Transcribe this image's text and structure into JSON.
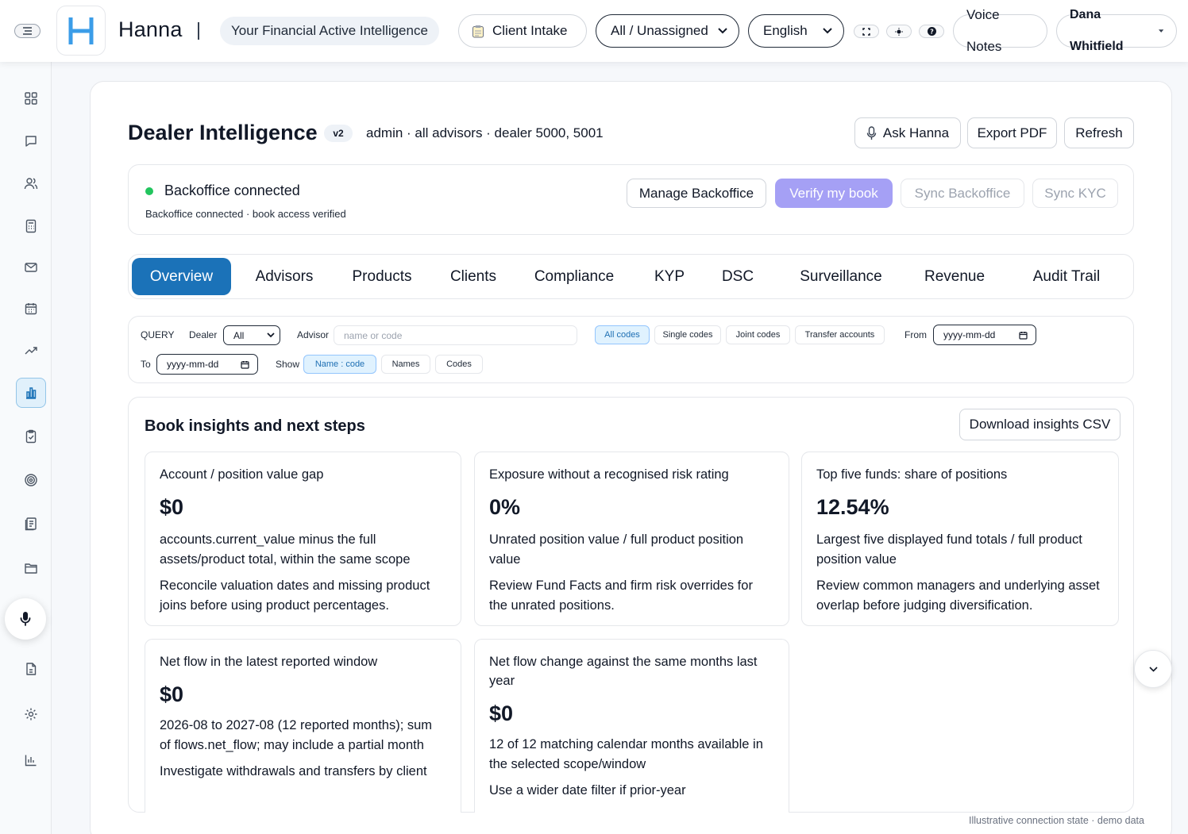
{
  "topbar": {
    "brand": "Hanna",
    "tagline": "Your Financial Active Intelligence",
    "client_intake": "Client Intake",
    "assignment_select": "All / Unassigned",
    "language_select": "English",
    "voice_notes": "Voice Notes",
    "user_name": "Dana Whitfield"
  },
  "header": {
    "title": "Dealer Intelligence",
    "version": "v2",
    "scope": "admin · all advisors · dealer 5000, 5001",
    "ask": "Ask Hanna",
    "export": "Export PDF",
    "refresh": "Refresh"
  },
  "backoffice": {
    "status": "Backoffice connected",
    "detail": "Backoffice connected · book access verified",
    "manage": "Manage Backoffice",
    "verify": "Verify my book",
    "sync": "Sync Backoffice",
    "sync_kyc": "Sync KYC",
    "status_color": "#22c55e"
  },
  "tabs": [
    "Overview",
    "Advisors",
    "Products",
    "Clients",
    "Compliance",
    "KYP",
    "DSC",
    "Surveillance",
    "Revenue",
    "Audit Trail"
  ],
  "query": {
    "label": "QUERY",
    "dealer_label": "Dealer",
    "dealer_value": "All",
    "advisor_label": "Advisor",
    "advisor_placeholder": "name or code",
    "code_filters": [
      "All codes",
      "Single codes",
      "Joint codes",
      "Transfer accounts"
    ],
    "from_label": "From",
    "from_placeholder": "yyyy-mm-dd",
    "to_label": "To",
    "to_placeholder": "yyyy-mm-dd",
    "show_label": "Show",
    "show_options": [
      "Name : code",
      "Names",
      "Codes"
    ]
  },
  "insights": {
    "title": "Book insights and next steps",
    "download": "Download insights CSV",
    "cards": [
      {
        "label": "Account / position value gap",
        "value": "$0",
        "desc": "accounts.current_value minus the full assets/product total, within the same scope",
        "action": "Reconcile valuation dates and missing product joins before using product percentages."
      },
      {
        "label": "Exposure without a recognised risk rating",
        "value": "0%",
        "desc": "Unrated position value / full product position value",
        "action": "Review Fund Facts and firm risk overrides for the unrated positions."
      },
      {
        "label": "Top five funds: share of positions",
        "value": "12.54%",
        "desc": "Largest five displayed fund totals / full product position value",
        "action": "Review common managers and underlying asset overlap before judging diversification."
      },
      {
        "label": "Net flow in the latest reported window",
        "value": "$0",
        "desc": "2026-08 to 2027-08 (12 reported months); sum of flows.net_flow; may include a partial month",
        "action": "Investigate withdrawals and transfers by client"
      },
      {
        "label": "Net flow change against the same months last year",
        "value": "$0",
        "desc": "12 of 12 matching calendar months available in the selected scope/window",
        "action": "Use a wider date filter if prior-year"
      }
    ]
  },
  "footnote": "Illustrative connection state · demo data",
  "colors": {
    "accent": "#1b72b8",
    "verify_button": "#a5a0f5"
  }
}
